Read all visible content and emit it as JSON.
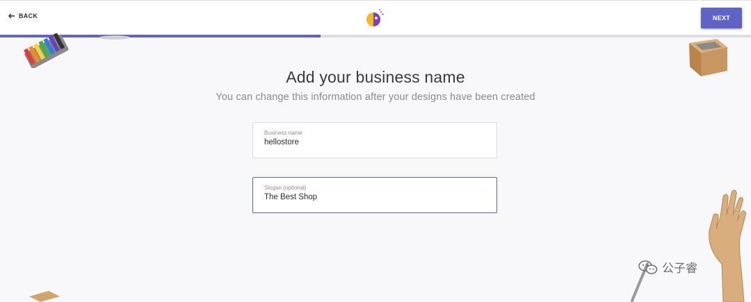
{
  "header": {
    "back_label": "BACK",
    "next_label": "NEXT"
  },
  "progress": {
    "percent": 42.7
  },
  "main": {
    "title": "Add your business name",
    "subtitle": "You can change this information after your designs have been created"
  },
  "form": {
    "business_name": {
      "label": "Business name",
      "value": "hellostore"
    },
    "slogan": {
      "label": "Slogan (optional)",
      "value": "The Best Shop"
    }
  },
  "watermark": {
    "text": "公子睿"
  },
  "colors": {
    "accent": "#5f63c6",
    "logo_yellow": "#f6b81e",
    "logo_purple": "#7b3fc0"
  }
}
